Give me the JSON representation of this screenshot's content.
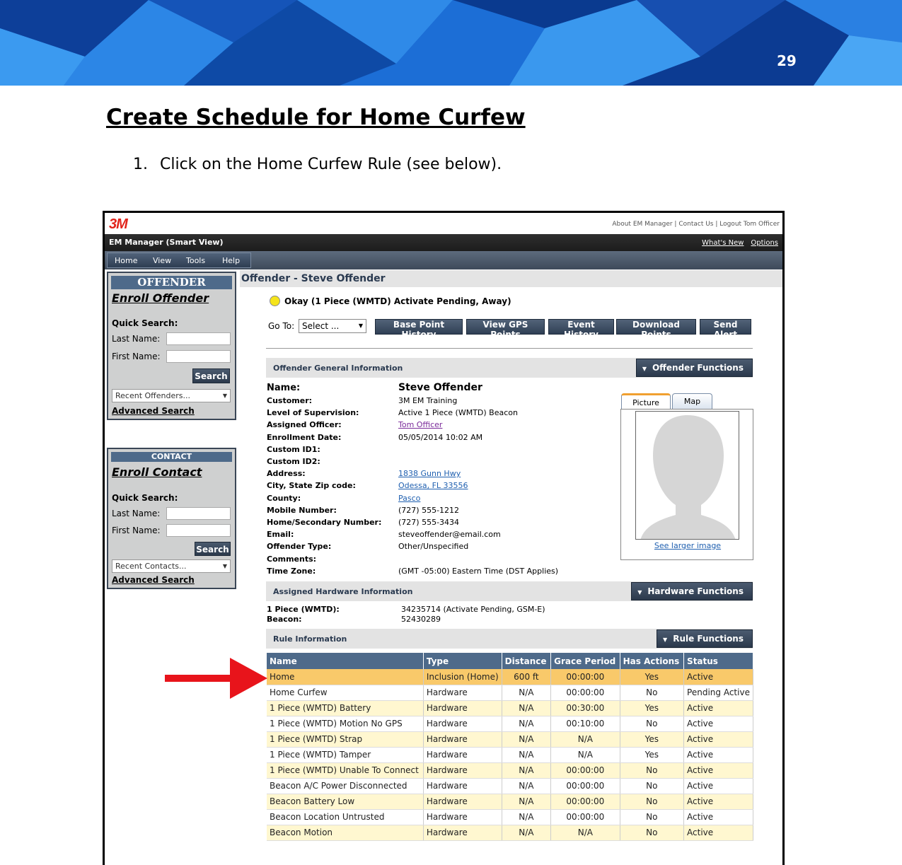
{
  "page_number": "29",
  "heading": "Create Schedule for Home Curfew",
  "step": {
    "number": "1.",
    "text": "Click on the Home Curfew Rule (see below)."
  },
  "app": {
    "logo": "3M",
    "top_links": "About EM Manager | Contact Us | Logout Tom Officer",
    "title": "EM Manager (Smart View)",
    "whats_new": "What's New",
    "options": "Options",
    "menu": [
      "Home",
      "View",
      "Tools",
      "Help"
    ]
  },
  "offender_panel": {
    "title": "OFFENDER",
    "enroll": "Enroll Offender",
    "quick_search": "Quick Search:",
    "last_name": "Last Name:",
    "first_name": "First Name:",
    "search": "Search",
    "recent": "Recent Offenders...",
    "advanced": "Advanced Search"
  },
  "contact_panel": {
    "title": "CONTACT",
    "enroll": "Enroll Contact",
    "quick_search": "Quick Search:",
    "last_name": "Last Name:",
    "first_name": "First Name:",
    "search": "Search",
    "recent": "Recent Contacts...",
    "advanced": "Advanced Search"
  },
  "offender": {
    "header": "Offender - Steve Offender",
    "status": "Okay (1 Piece (WMTD) Activate Pending, Away)",
    "goto_label": "Go To:",
    "goto_value": "Select ...",
    "buttons": [
      "Base Point History",
      "View GPS Points",
      "Event History",
      "Download Points",
      "Send Alert"
    ]
  },
  "general": {
    "title": "Offender General Information",
    "functions": "Offender Functions",
    "fields": [
      {
        "label": "Name:",
        "value": "Steve Offender"
      },
      {
        "label": "Customer:",
        "value": "3M EM Training"
      },
      {
        "label": "Level of Supervision:",
        "value": "Active 1 Piece (WMTD) Beacon"
      },
      {
        "label": "Assigned Officer:",
        "value": "Tom Officer"
      },
      {
        "label": "Enrollment Date:",
        "value": "05/05/2014 10:02 AM"
      },
      {
        "label": "Custom ID1:",
        "value": ""
      },
      {
        "label": "Custom ID2:",
        "value": ""
      },
      {
        "label": "Address:",
        "value": "1838 Gunn Hwy"
      },
      {
        "label": "City, State Zip code:",
        "value": "Odessa, FL 33556"
      },
      {
        "label": "County:",
        "value": "Pasco"
      },
      {
        "label": "Mobile Number:",
        "value": "(727) 555-1212"
      },
      {
        "label": "Home/Secondary Number:",
        "value": "(727) 555-3434"
      },
      {
        "label": "Email:",
        "value": "steveoffender@email.com"
      },
      {
        "label": "Offender Type:",
        "value": "Other/Unspecified"
      },
      {
        "label": "Comments:",
        "value": ""
      },
      {
        "label": "Time Zone:",
        "value": "(GMT -05:00) Eastern Time (DST Applies)"
      }
    ],
    "tab_picture": "Picture",
    "tab_map": "Map",
    "larger_image": "See larger image"
  },
  "hardware": {
    "title": "Assigned Hardware Information",
    "functions": "Hardware Functions",
    "items": [
      {
        "label": "1 Piece (WMTD):",
        "value": "34235714 (Activate Pending, GSM-E)"
      },
      {
        "label": "Beacon:",
        "value": "52430289"
      }
    ]
  },
  "rules": {
    "title": "Rule Information",
    "functions": "Rule Functions",
    "columns": [
      "Name",
      "Type",
      "Distance",
      "Grace Period",
      "Has Actions",
      "Status"
    ],
    "rows": [
      [
        "Home",
        "Inclusion (Home)",
        "600 ft",
        "00:00:00",
        "Yes",
        "Active"
      ],
      [
        "Home Curfew",
        "Hardware",
        "N/A",
        "00:00:00",
        "No",
        "Pending Active"
      ],
      [
        "1 Piece (WMTD) Battery",
        "Hardware",
        "N/A",
        "00:30:00",
        "Yes",
        "Active"
      ],
      [
        "1 Piece (WMTD) Motion No GPS",
        "Hardware",
        "N/A",
        "00:10:00",
        "No",
        "Active"
      ],
      [
        "1 Piece (WMTD) Strap",
        "Hardware",
        "N/A",
        "N/A",
        "Yes",
        "Active"
      ],
      [
        "1 Piece (WMTD) Tamper",
        "Hardware",
        "N/A",
        "N/A",
        "Yes",
        "Active"
      ],
      [
        "1 Piece (WMTD) Unable To Connect",
        "Hardware",
        "N/A",
        "00:00:00",
        "No",
        "Active"
      ],
      [
        "Beacon A/C Power Disconnected",
        "Hardware",
        "N/A",
        "00:00:00",
        "No",
        "Active"
      ],
      [
        "Beacon Battery Low",
        "Hardware",
        "N/A",
        "00:00:00",
        "No",
        "Active"
      ],
      [
        "Beacon Location Untrusted",
        "Hardware",
        "N/A",
        "00:00:00",
        "No",
        "Active"
      ],
      [
        "Beacon Motion",
        "Hardware",
        "N/A",
        "N/A",
        "No",
        "Active"
      ]
    ]
  },
  "colors": {
    "banner": "#1f6fd0",
    "header_blue": "#4e6a8a",
    "highlight": "#f9c96a",
    "arrow": "#e8141b"
  }
}
